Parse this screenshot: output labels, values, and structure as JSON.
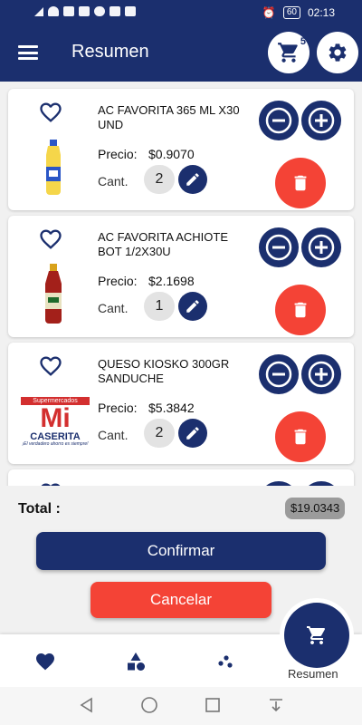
{
  "status_bar": {
    "battery": "60",
    "time": "02:13"
  },
  "app_bar": {
    "title": "Resumen",
    "cart_count": "5"
  },
  "items": [
    {
      "name": "AC FAVORITA 365 ML X30 UND",
      "price_label": "Precio:",
      "price": "$0.9070",
      "qty_label": "Cant.",
      "qty": "2"
    },
    {
      "name": "AC FAVORITA ACHIOTE BOT 1/2X30U",
      "price_label": "Precio:",
      "price": "$2.1698",
      "qty_label": "Cant.",
      "qty": "1"
    },
    {
      "name": "QUESO KIOSKO 300GR SANDUCHE",
      "price_label": "Precio:",
      "price": "$5.3842",
      "qty_label": "Cant.",
      "qty": "2"
    }
  ],
  "logo": {
    "line1": "Supermercados",
    "line2": "Mi",
    "line3": "CASERITA",
    "tagline": "¡El verdadero ahorro es siempre!"
  },
  "footer": {
    "total_label": "Total :",
    "total_value": "$19.0343",
    "confirm_label": "Confirmar",
    "cancel_label": "Cancelar"
  },
  "bottom_nav": {
    "active_label": "Resumen"
  },
  "icons": {
    "menu": "menu-icon",
    "cart": "cart-icon",
    "settings": "gear-icon",
    "favorite": "heart-outline-icon",
    "minus": "minus-circle-icon",
    "plus": "plus-circle-icon",
    "edit": "pencil-icon",
    "delete": "trash-icon"
  },
  "colors": {
    "primary": "#1b2f6e",
    "danger": "#f44336",
    "qty_bg": "#e3e3e3",
    "total_badge": "#9b9b9b"
  }
}
